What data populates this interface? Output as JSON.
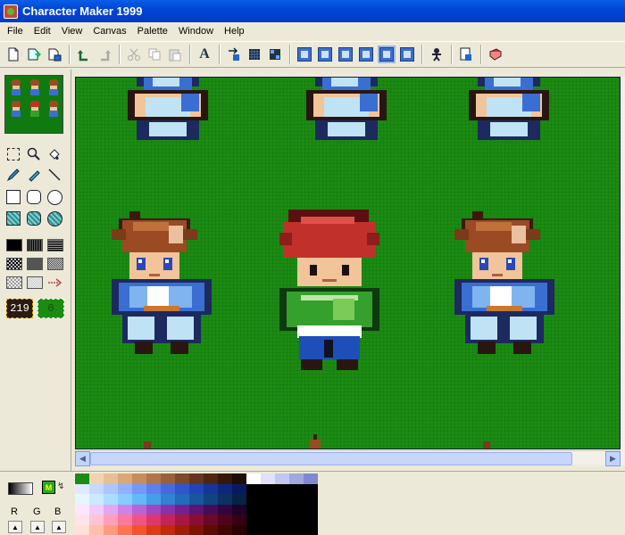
{
  "window": {
    "title": "Character Maker 1999"
  },
  "menu": [
    "File",
    "Edit",
    "View",
    "Canvas",
    "Palette",
    "Window",
    "Help"
  ],
  "toolbar": {
    "text_tool_glyph": "A",
    "icons": [
      "new-icon",
      "open-icon",
      "save-icon",
      "undo-icon",
      "redo-icon",
      "cut-icon",
      "copy-icon",
      "paste-icon",
      "text-icon",
      "flip-icon",
      "grid-icon",
      "tile-icon",
      "view1-icon",
      "view2-icon",
      "view3-icon",
      "view4-icon",
      "view5-icon",
      "view6-icon",
      "character-icon",
      "preview-icon",
      "book-icon"
    ]
  },
  "tools": {
    "foreground_index": "219",
    "background_index": "0"
  },
  "rgb": {
    "r_label": "R",
    "g_label": "G",
    "b_label": "B"
  },
  "colors": {
    "canvas_bg": "#1b8c12",
    "titlebar": "#0046d5",
    "foreground": "#2b1a10",
    "background": "#1b8c12"
  },
  "palette": [
    "#1b8c12",
    "#f2d3b0",
    "#e8bf94",
    "#d9a878",
    "#c68d5e",
    "#b0754a",
    "#996039",
    "#7f4a2a",
    "#65361d",
    "#4c2613",
    "#36180b",
    "#1f0c04",
    "#ffffff",
    "#e0e0ff",
    "#c0c8f0",
    "#a0a8e0",
    "#8088d0",
    "#dfe9ff",
    "#c7d8ff",
    "#aec5ff",
    "#92b0ff",
    "#7798f8",
    "#5d80ee",
    "#4569e0",
    "#3155cf",
    "#2244b8",
    "#17349c",
    "#0e267e",
    "#081a5f",
    "#000000",
    "#000000",
    "#000000",
    "#000000",
    "#000000",
    "#e6f5ff",
    "#c9eaff",
    "#a9dcff",
    "#86ccff",
    "#63b8f7",
    "#479ee6",
    "#3283d1",
    "#236cb8",
    "#19569c",
    "#11437e",
    "#0b3262",
    "#062248",
    "#000000",
    "#000000",
    "#000000",
    "#000000",
    "#000000",
    "#fbe6ff",
    "#f1c9fb",
    "#e2a6f2",
    "#d083e6",
    "#bb62d6",
    "#a246c2",
    "#8931a9",
    "#72218e",
    "#5b1573",
    "#450c58",
    "#310640",
    "#1f022a",
    "#000000",
    "#000000",
    "#000000",
    "#000000",
    "#000000",
    "#ffe3ec",
    "#ffc3d5",
    "#ff9fbb",
    "#fb78a0",
    "#ef5486",
    "#dc376e",
    "#c42459",
    "#a71746",
    "#880e36",
    "#690828",
    "#4d041c",
    "#330111",
    "#000000",
    "#000000",
    "#000000",
    "#000000",
    "#000000",
    "#ffe0d6",
    "#ffbfa9",
    "#ff9a7b",
    "#ff754f",
    "#f4542c",
    "#dd3b16",
    "#c12a0b",
    "#a01e05",
    "#7e1402",
    "#5d0c01",
    "#400600",
    "#280300",
    "#000000",
    "#000000",
    "#000000",
    "#000000",
    "#000000"
  ]
}
